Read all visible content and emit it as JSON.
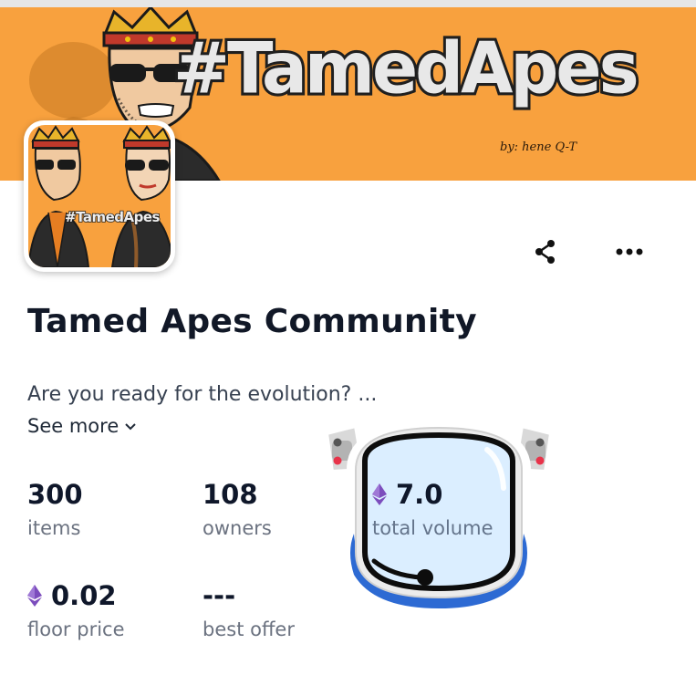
{
  "banner": {
    "logo_text": "#TamedApes",
    "credit_text": "by: hene Q-T"
  },
  "avatar": {
    "logo_text": "#TamedApes"
  },
  "actions": {
    "share_icon": "share-icon",
    "more_icon": "more-horizontal-icon"
  },
  "collection": {
    "title": "Tamed Apes Community",
    "description": "Are you ready for the evolution? ...",
    "see_more_label": "See more"
  },
  "stats": {
    "items": {
      "value": "300",
      "label": "items"
    },
    "owners": {
      "value": "108",
      "label": "owners"
    },
    "total_volume": {
      "value": "7.0",
      "label": "total volume",
      "currency_icon": "ethereum-icon"
    },
    "floor_price": {
      "value": "0.02",
      "label": "floor price",
      "currency_icon": "ethereum-icon"
    },
    "best_offer": {
      "value": "---",
      "label": "best offer"
    }
  },
  "colors": {
    "banner_orange": "#f8a13e",
    "eth_purple": "#7c4dbd",
    "text_dark": "#0f172a",
    "text_muted": "#6b7280"
  }
}
